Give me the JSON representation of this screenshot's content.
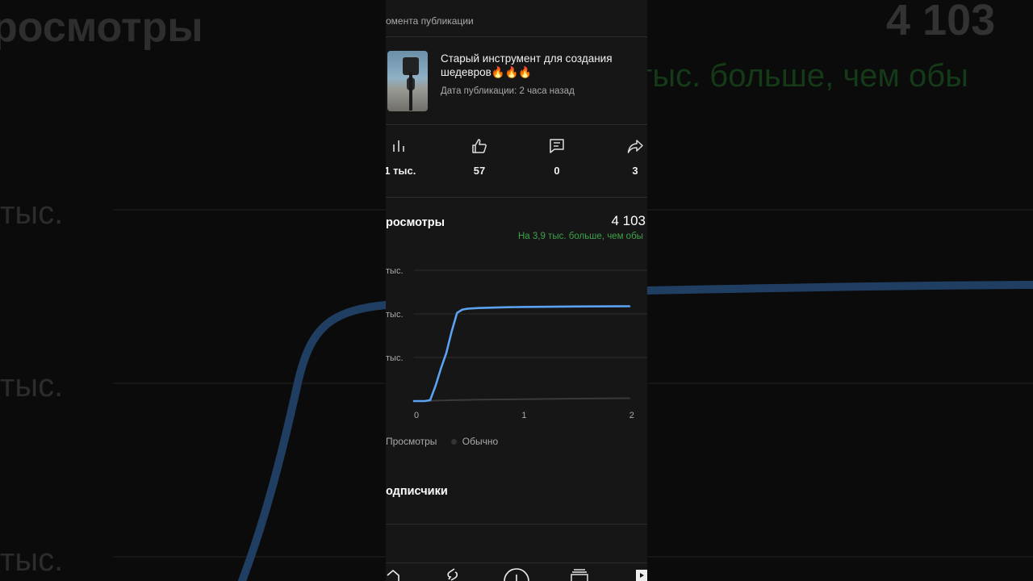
{
  "header": {
    "caption": "омента публикации"
  },
  "video": {
    "title": "Старый инструмент для создания шедевров🔥🔥🔥",
    "published": "Дата публикации: 2 часа назад"
  },
  "stats": {
    "views": ",1 тыс.",
    "likes": "57",
    "comments": "0",
    "shares": "3"
  },
  "views_section": {
    "title": "росмотры",
    "value": "4 103",
    "diff": "На 3,9 тыс. больше, чем обы"
  },
  "chart_data": {
    "type": "line",
    "x": [
      0,
      0.1,
      0.15,
      0.2,
      0.25,
      0.3,
      0.35,
      0.4,
      0.45,
      0.5,
      0.6,
      0.8,
      1.0,
      1.5,
      2.0
    ],
    "series": [
      {
        "name": "Просмотры",
        "values": [
          0,
          0,
          40,
          700,
          1500,
          2200,
          3200,
          4050,
          4200,
          4240,
          4270,
          4300,
          4320,
          4340,
          4350
        ]
      },
      {
        "name": "Обычно",
        "values": [
          0,
          0,
          10,
          18,
          25,
          32,
          40,
          45,
          50,
          55,
          62,
          75,
          85,
          110,
          130
        ]
      }
    ],
    "y_tick_labels": [
      "тыс.",
      "тыс.",
      "тыс."
    ],
    "x_tick_labels": [
      "0",
      "1",
      "2"
    ],
    "ylim": [
      0,
      6000
    ],
    "xlim": [
      0,
      2
    ],
    "grid": true,
    "legend": "bottom-left",
    "colors": {
      "views": "#5ba3f2",
      "typical": "#3a3a3a"
    }
  },
  "legend": {
    "views": "Просмотры",
    "typical": "Обычно"
  },
  "subscribers_section": {
    "title": "одписчики"
  },
  "background": {
    "title": "росмотры",
    "value": "4 103",
    "diff": "тыс. больше, чем обы",
    "tick_1": "тыс.",
    "tick_2": "тыс.",
    "tick_3": "тыс."
  },
  "icons": {
    "views": "bar-chart-icon",
    "likes": "thumb-up-icon",
    "comments": "comment-icon",
    "shares": "share-icon"
  }
}
